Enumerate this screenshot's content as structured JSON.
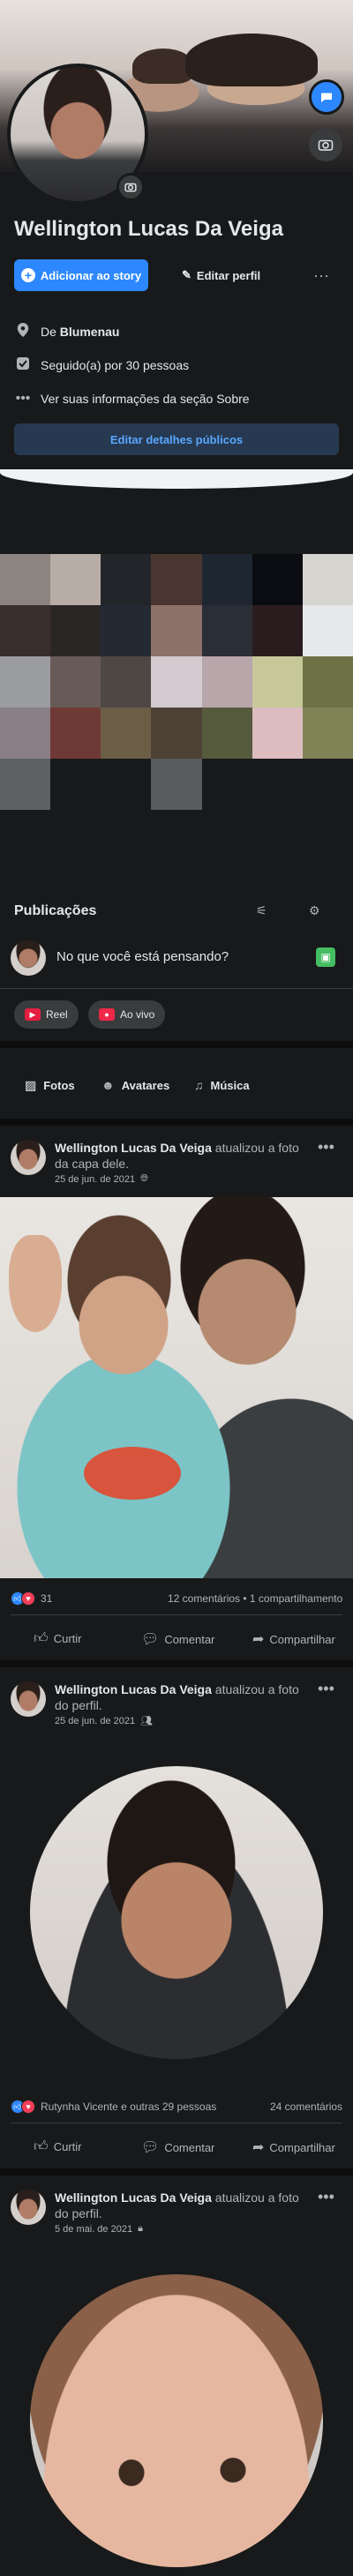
{
  "profile": {
    "name": "Wellington Lucas Da Veiga",
    "add_story_label": "Adicionar ao story",
    "edit_profile_label": "Editar perfil",
    "more_label": "···"
  },
  "info": {
    "city_prefix": "De ",
    "city": "Blumenau",
    "followers": "Seguido(a) por 30 pessoas",
    "about": "Ver suas informações da seção Sobre",
    "edit_public_label": "Editar detalhes públicos"
  },
  "mosaic_colors": [
    "#8c8480",
    "#b8aca6",
    "#22262b",
    "#4a3630",
    "#1e2632",
    "#0b0c12",
    "#d7d5d0",
    "#3a2f2c",
    "#2a2626",
    "#242a33",
    "#8c7168",
    "#2a2e36",
    "#2a1c1e",
    "#e6e8ea",
    "#9b9ca0",
    "#685a57",
    "#4e4744",
    "#d4cad0",
    "#b8a6aa",
    "#c6c89a",
    "#6c7246",
    "#8a7f86",
    "#6f3a36",
    "#6a5e46",
    "#4e4236",
    "#575b3e",
    "#ddbcc0",
    "#7e8356",
    "#5e6064",
    "#18191a",
    "#18191a",
    "#5a5b5e",
    "#18191a",
    "#18191a",
    "#18191a"
  ],
  "publications": {
    "title": "Publicações",
    "composer_placeholder": "No que você está pensando?",
    "chips": [
      {
        "label": "Reel"
      },
      {
        "label": "Ao vivo"
      }
    ],
    "tabs": [
      {
        "label": "Fotos"
      },
      {
        "label": "Avatares"
      },
      {
        "label": "Música"
      }
    ]
  },
  "posts": [
    {
      "author": "Wellington Lucas Da Veiga",
      "action": " atualizou a foto da capa dele.",
      "date": "25 de jun. de 2021",
      "privacy_icon": "globe-icon",
      "reactions_count": "31",
      "comments_shares": "12 comentários • 1 compartilhamento"
    },
    {
      "author": "Wellington Lucas Da Veiga",
      "action": " atualizou a foto do perfil.",
      "date": "25 de jun. de 2021",
      "privacy_icon": "friends-icon",
      "reactions_count": "Rutynha Vicente e outras 29 pessoas",
      "comments_shares": "24 comentários"
    },
    {
      "author": "Wellington Lucas Da Veiga",
      "action": " atualizou a foto do perfil.",
      "date": "5 de mai. de 2021",
      "privacy_icon": "lock-icon"
    }
  ],
  "actions": {
    "like": "Curtir",
    "comment": "Comentar",
    "share": "Compartilhar"
  },
  "colors": {
    "background": "#18191a",
    "accent": "#2d88ff",
    "text": "#e4e6eb",
    "secondary_text": "#b0b3b8"
  }
}
